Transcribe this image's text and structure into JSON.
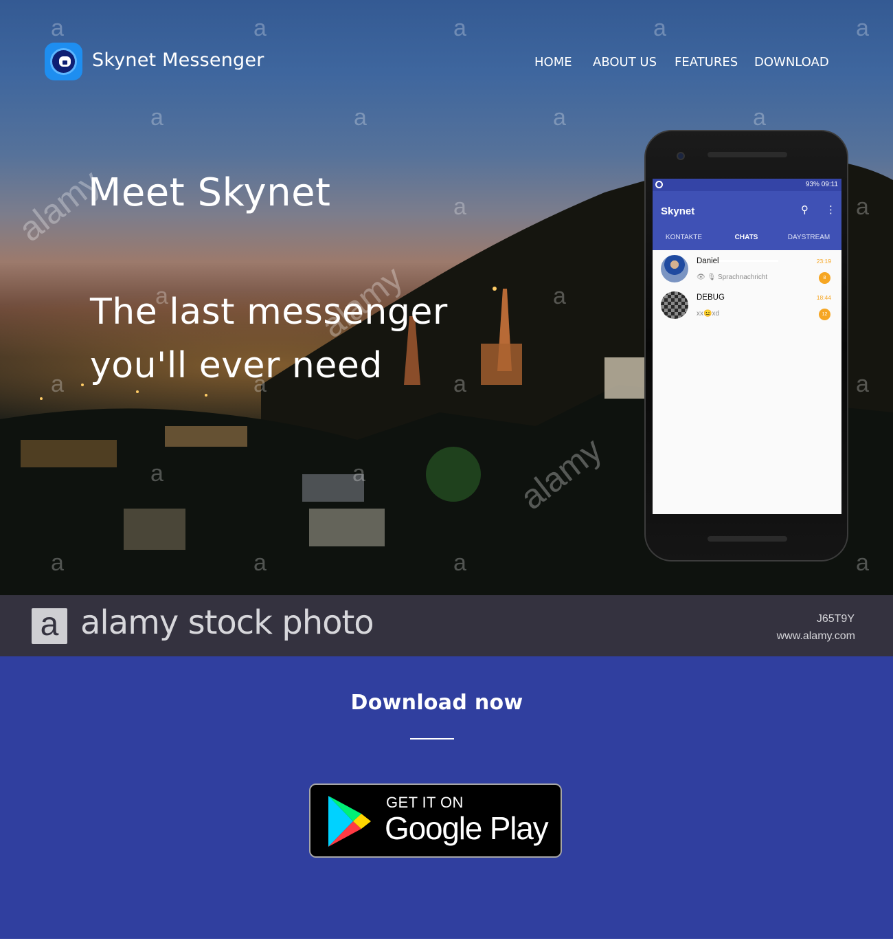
{
  "header": {
    "app_name": "Skynet Messenger",
    "nav": [
      "HOME",
      "ABOUT US",
      "FEATURES",
      "DOWNLOAD"
    ]
  },
  "hero": {
    "title": "Meet Skynet",
    "tagline_line1": "The last messenger",
    "tagline_line2": "you'll ever need"
  },
  "phone": {
    "status": {
      "battery": "93%",
      "time": "09:11"
    },
    "app_title": "Skynet",
    "tabs": [
      "KONTAKTE",
      "CHATS",
      "DAYSTREAM"
    ],
    "active_tab": "CHATS",
    "chats": [
      {
        "name": "Daniel",
        "message": "Sprachnachricht",
        "time": "23:19",
        "badge": "8"
      },
      {
        "name": "DEBUG",
        "message": "xx😐xd",
        "time": "18:44",
        "badge": "12"
      }
    ]
  },
  "stock_overlay": {
    "brand": "alamy stock photo",
    "image_id": "J65T9Y",
    "site": "www.alamy.com",
    "watermark_glyph": "a",
    "watermark_word": "alamy"
  },
  "download": {
    "heading": "Download now",
    "badge_top": "GET IT ON",
    "badge_store": "Google Play"
  },
  "colors": {
    "brand_primary": "#3f51b5",
    "section_bg": "#303f9f",
    "accent_orange": "#f6a623",
    "stock_bar": "#34323f"
  },
  "icons": [
    "skynet-logo-icon",
    "search-icon",
    "more-vert-icon",
    "google-play-icon",
    "alamy-logo-icon"
  ]
}
